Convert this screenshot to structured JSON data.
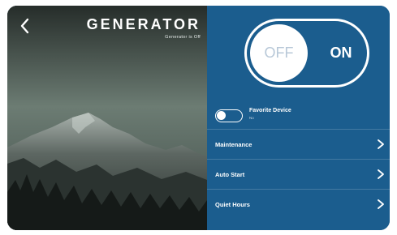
{
  "header": {
    "title": "GENERATOR",
    "status_text": "Generator is Off"
  },
  "power_toggle": {
    "off_label": "OFF",
    "on_label": "ON",
    "selected": "OFF"
  },
  "favorite": {
    "label": "Favorite Device",
    "value": "No"
  },
  "menu": [
    {
      "label": "Maintenance"
    },
    {
      "label": "Auto Start"
    },
    {
      "label": "Quiet Hours"
    }
  ],
  "colors": {
    "panel": "#1b5d8e",
    "text": "#ffffff"
  },
  "icons": {
    "back": "chevron-left-icon",
    "row": "chevron-right-icon"
  }
}
